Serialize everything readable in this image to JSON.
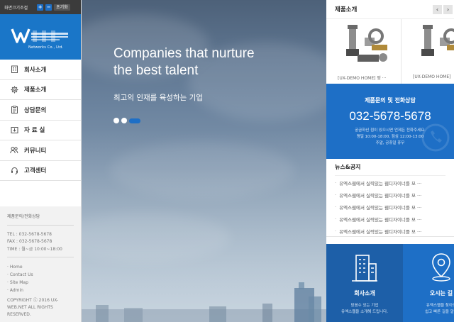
{
  "toolbar": {
    "font_size_label": "화면크기조절",
    "zoom_in": "+",
    "zoom_out": "−",
    "reset": "초기화"
  },
  "logo": {
    "subtitle": "Networks Co., Ltd."
  },
  "menu": [
    {
      "label": "회사소개",
      "icon": "building-icon"
    },
    {
      "label": "제품소개",
      "icon": "gear-icon"
    },
    {
      "label": "상담문의",
      "icon": "clipboard-icon"
    },
    {
      "label": "자 료 실",
      "icon": "download-icon"
    },
    {
      "label": "커뮤니티",
      "icon": "users-icon"
    },
    {
      "label": "고객센터",
      "icon": "headset-icon"
    }
  ],
  "sidebar_info": {
    "title": "제품문의/전화상담",
    "tel": "TEL : 032-5678-5678",
    "fax": "FAX : 032-5678-5678",
    "time": "TIME : 월~금 10:00~18:00",
    "links": [
      "· Home",
      "· Contact Us",
      "· Site Map",
      "· Admin"
    ],
    "copyright": "COPYRIGHT ⓒ 2016 UX-WEB.NET ALL RIGHTS RESERVED."
  },
  "hero": {
    "title_line1": "Companies that nurture",
    "title_line2": "the best talent",
    "subtitle": "최고의 인재를 육성하는 기업"
  },
  "products": {
    "title": "제품소개",
    "prev": "‹",
    "next": "›",
    "items": [
      {
        "name": "[UX-DEMO HOME] 펑 ···"
      },
      {
        "name": "[UX-DEMO HOME]"
      }
    ]
  },
  "contact": {
    "title": "제품문의 및 전화상담",
    "phone": "032-5678-5678",
    "desc1": "궁금하신 점이 있으시면 언제든 전화주세요.",
    "desc2": "평일 10:00-18:00, 점심 12:00-13:00",
    "desc3": "주말, 공휴일 휴무"
  },
  "news": {
    "title": "뉴스&공지",
    "items": [
      "유엑스웹에서 실력있는 웹디자이너를 모 ···",
      "유엑스웹에서 실력있는 웹디자이너를 모 ···",
      "유엑스웹에서 실력있는 웹디자이너를 모 ···",
      "유엑스웹에서 실력있는 웹디자이너를 모 ···",
      "유엑스웹에서 실력있는 웹디자이너를 모 ···"
    ]
  },
  "quick": [
    {
      "title": "회사소개",
      "desc1": "믿음수 있는 기업",
      "desc2": "유엑스웹을 소개해 드립니다."
    },
    {
      "title": "오시는 길",
      "desc1": "유엑스웹을 찾아오",
      "desc2": "쉽고 빠른 길을 알려"
    }
  ],
  "colors": {
    "accent": "#1e6fc6",
    "accent_dark": "#1d5fa8",
    "topbar": "#3b3b3b"
  }
}
